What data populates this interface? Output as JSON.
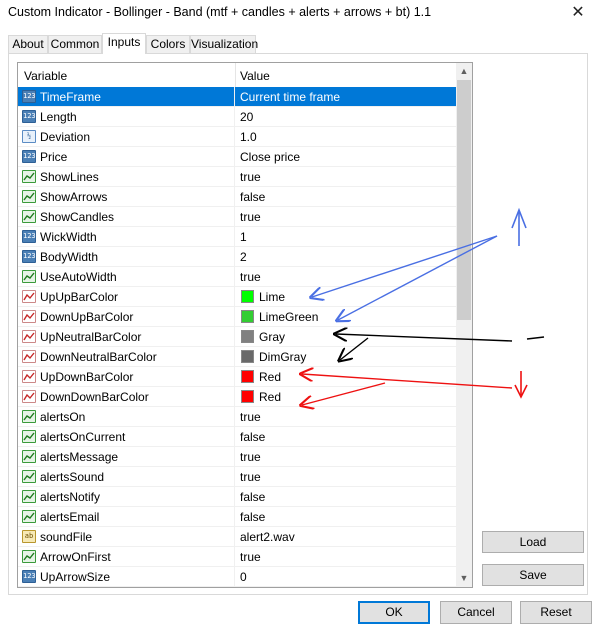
{
  "window": {
    "title": "Custom Indicator - Bollinger - Band (mtf + candles + alerts + arrows + bt) 1.1",
    "close_glyph": "✕"
  },
  "tabs": [
    {
      "label": "About"
    },
    {
      "label": "Common"
    },
    {
      "label": "Inputs",
      "active": true
    },
    {
      "label": "Colors"
    },
    {
      "label": "Visualization"
    }
  ],
  "grid": {
    "col_variable": "Variable",
    "col_value": "Value",
    "rows": [
      {
        "icon": "int-icon",
        "icon_text": "123",
        "name": "TimeFrame",
        "value": "Current time frame",
        "selected": true
      },
      {
        "icon": "int-icon",
        "icon_text": "123",
        "name": "Length",
        "value": "20"
      },
      {
        "icon": "double-icon",
        "icon_text": "½",
        "name": "Deviation",
        "value": "1.0"
      },
      {
        "icon": "enum-icon",
        "icon_text": "123",
        "name": "Price",
        "value": "Close price"
      },
      {
        "icon": "bool-icon",
        "name": "ShowLines",
        "value": "true"
      },
      {
        "icon": "bool-icon",
        "name": "ShowArrows",
        "value": "false"
      },
      {
        "icon": "bool-icon",
        "name": "ShowCandles",
        "value": "true"
      },
      {
        "icon": "int-icon",
        "icon_text": "123",
        "name": "WickWidth",
        "value": "1"
      },
      {
        "icon": "int-icon",
        "icon_text": "123",
        "name": "BodyWidth",
        "value": "2"
      },
      {
        "icon": "bool-icon",
        "name": "UseAutoWidth",
        "value": "true"
      },
      {
        "icon": "color-icon",
        "name": "UpUpBarColor",
        "value": "Lime",
        "swatch": "#00ff00"
      },
      {
        "icon": "color-icon",
        "name": "DownUpBarColor",
        "value": "LimeGreen",
        "swatch": "#32cd32"
      },
      {
        "icon": "color-icon",
        "name": "UpNeutralBarColor",
        "value": "Gray",
        "swatch": "#808080"
      },
      {
        "icon": "color-icon",
        "name": "DownNeutralBarColor",
        "value": "DimGray",
        "swatch": "#696969"
      },
      {
        "icon": "color-icon",
        "name": "UpDownBarColor",
        "value": "Red",
        "swatch": "#ff0000"
      },
      {
        "icon": "color-icon",
        "name": "DownDownBarColor",
        "value": "Red",
        "swatch": "#ff0000"
      },
      {
        "icon": "bool-icon",
        "name": "alertsOn",
        "value": "true"
      },
      {
        "icon": "bool-icon",
        "name": "alertsOnCurrent",
        "value": "false"
      },
      {
        "icon": "bool-icon",
        "name": "alertsMessage",
        "value": "true"
      },
      {
        "icon": "bool-icon",
        "name": "alertsSound",
        "value": "true"
      },
      {
        "icon": "bool-icon",
        "name": "alertsNotify",
        "value": "false"
      },
      {
        "icon": "bool-icon",
        "name": "alertsEmail",
        "value": "false"
      },
      {
        "icon": "string-icon",
        "icon_text": "ab",
        "name": "soundFile",
        "value": "alert2.wav"
      },
      {
        "icon": "bool-icon",
        "name": "ArrowOnFirst",
        "value": "true"
      },
      {
        "icon": "int-icon",
        "icon_text": "123",
        "name": "UpArrowSize",
        "value": "0"
      }
    ]
  },
  "side_buttons": {
    "load": "Load",
    "save": "Save"
  },
  "footer": {
    "ok": "OK",
    "cancel": "Cancel",
    "reset": "Reset"
  },
  "colors": {
    "selection": "#0078d7",
    "annotation_blue": "#4a6fe3",
    "annotation_black": "#000000",
    "annotation_red": "#ee1111"
  }
}
